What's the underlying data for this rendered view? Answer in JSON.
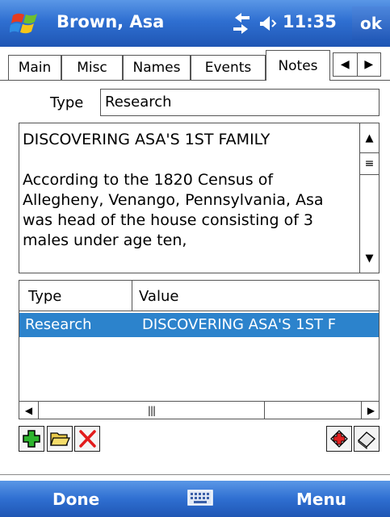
{
  "titlebar": {
    "title": "Brown, Asa",
    "time": "11:35",
    "ok_label": "ok"
  },
  "tabs": [
    {
      "label": "Main"
    },
    {
      "label": "Misc"
    },
    {
      "label": "Names"
    },
    {
      "label": "Events"
    },
    {
      "label": "Notes"
    }
  ],
  "active_tab": "Notes",
  "form": {
    "type_label": "Type",
    "type_value": "Research",
    "notes_text": "DISCOVERING ASA'S 1ST FAMILY\n\nAccording to the 1820 Census of Allegheny, Venango, Pennsylvania, Asa was head of the house consisting of 3 males under age ten,"
  },
  "list": {
    "headers": [
      "Type",
      "Value"
    ],
    "rows": [
      {
        "type": "Research",
        "value": "DISCOVERING ASA'S 1ST F"
      }
    ]
  },
  "menubar": {
    "left": "Done",
    "right": "Menu"
  },
  "colors": {
    "titlebar": "#2f6fd1",
    "selection": "#2c83cc"
  },
  "icons": [
    "windows-flag-icon",
    "connectivity-icon",
    "volume-icon",
    "add-icon",
    "open-folder-icon",
    "delete-icon",
    "add-record-icon",
    "eraser-icon",
    "keyboard-icon"
  ]
}
